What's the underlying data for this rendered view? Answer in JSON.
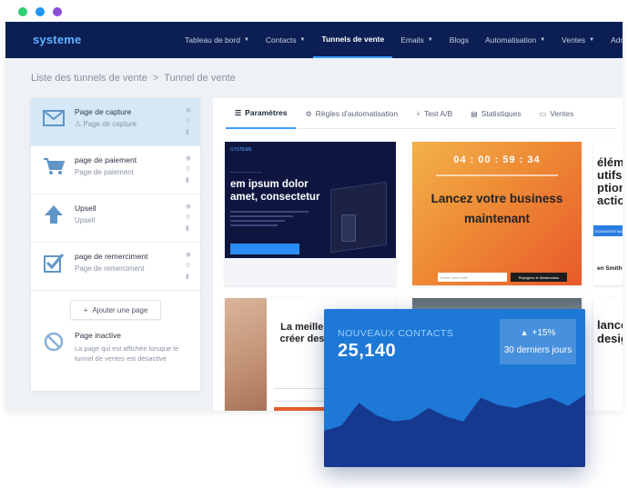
{
  "brand": {
    "logo": "systeme"
  },
  "nav": {
    "items": [
      {
        "label": "Tableau de bord",
        "caret": true
      },
      {
        "label": "Contacts",
        "caret": true
      },
      {
        "label": "Tunnels de vente",
        "caret": false,
        "active": true
      },
      {
        "label": "Emails",
        "caret": true
      },
      {
        "label": "Blogs",
        "caret": false
      },
      {
        "label": "Automatisation",
        "caret": true
      },
      {
        "label": "Ventes",
        "caret": true
      },
      {
        "label": "Admi",
        "caret": false
      }
    ]
  },
  "breadcrumb": {
    "parent": "Liste des tunnels de vente",
    "sep": ">",
    "current": "Tunnel de vente"
  },
  "sidebar": {
    "steps": [
      {
        "title": "Page de capture",
        "subtitle": "Page de capture",
        "icon": "envelope-icon",
        "warn": "⚠"
      },
      {
        "title": "page de paiement",
        "subtitle": "Page de paiement",
        "icon": "cart-icon"
      },
      {
        "title": "Upsell",
        "subtitle": "Upsell",
        "icon": "arrow-up-icon"
      },
      {
        "title": "page de remerciment",
        "subtitle": "Page de remerciment",
        "icon": "checkbox-icon"
      }
    ],
    "add_label": "Ajouter une page",
    "inactive": {
      "title": "Page inactive",
      "desc": "La page qui est affichée lorsque le tunnel de ventes est désactivé"
    }
  },
  "tabs": [
    {
      "label": "Paramètres",
      "icon": "list-icon"
    },
    {
      "label": "Règles d'automatisation",
      "icon": "gears-icon"
    },
    {
      "label": "Test A/B",
      "icon": "split-icon"
    },
    {
      "label": "Statistiques",
      "icon": "bar-chart-icon"
    },
    {
      "label": "Ventes",
      "icon": "money-icon"
    }
  ],
  "templates": {
    "t1": {
      "header": "SYSTEME",
      "headline": "em ipsum dolor amet, consectetur"
    },
    "t2": {
      "timer": "04 : 00 : 59 : 34",
      "headline": "Lancez votre business maintenant",
      "button": "Rejoignez le Masterclass",
      "input_ph": "Entrer votre mail"
    },
    "t3": {
      "headline": "élémé utifs ption action",
      "button": "ECHANGER MAIN",
      "who": "en Smith"
    },
    "t4": {
      "headline": "La meille méthode p créer des p de captu"
    },
    "t6": {
      "headline": "lance desig"
    }
  },
  "stats_card": {
    "label": "NOUVEAUX CONTACTS",
    "value": "25,140",
    "change": "+15%",
    "period": "30 derniers jours",
    "colors": {
      "card": "#1e78d6",
      "area": "#16388f"
    }
  },
  "chart_data": {
    "type": "area",
    "series": [
      {
        "values": [
          35,
          40,
          62,
          50,
          44,
          46,
          57,
          49,
          44,
          67,
          60,
          57,
          62,
          67,
          59,
          70
        ]
      }
    ],
    "ylim": [
      0,
      100
    ]
  }
}
